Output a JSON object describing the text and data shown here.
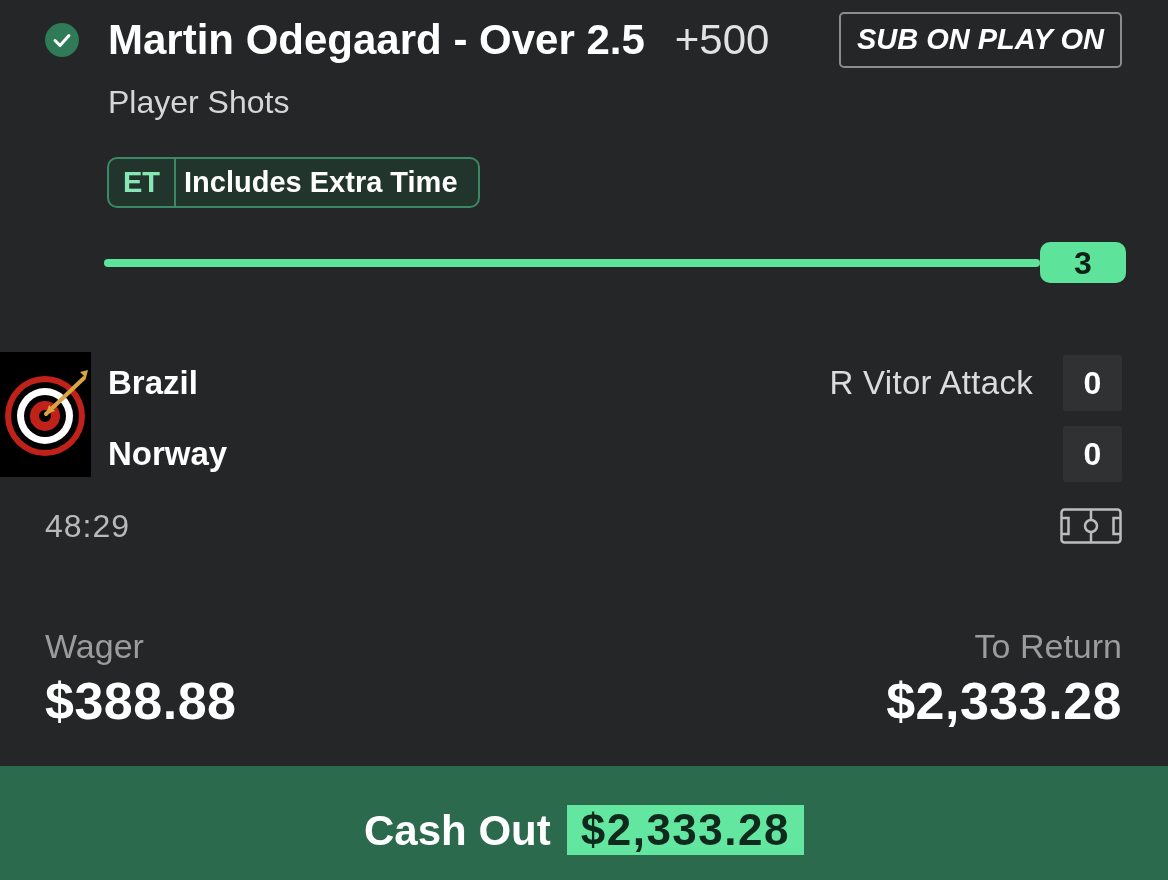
{
  "selection": {
    "checked": true,
    "title": "Martin Odegaard - Over 2.5",
    "odds": "+500",
    "market": "Player Shots",
    "badge": "SUB ON PLAY ON"
  },
  "tag": {
    "code": "ET",
    "label": "Includes Extra Time"
  },
  "progress": {
    "level": 1,
    "reading": "3"
  },
  "match": {
    "teams": [
      {
        "name": "Brazil",
        "note": "R Vitor Attack",
        "score": "0"
      },
      {
        "name": "Norway",
        "score": "0"
      }
    ],
    "clock": "48:29"
  },
  "wager": {
    "label": "Wager",
    "value": "$388.88"
  },
  "returns": {
    "label": "To Return",
    "value": "$2,333.28"
  },
  "cash_out": {
    "label": "Cash Out",
    "amount": "$2,333.28"
  }
}
